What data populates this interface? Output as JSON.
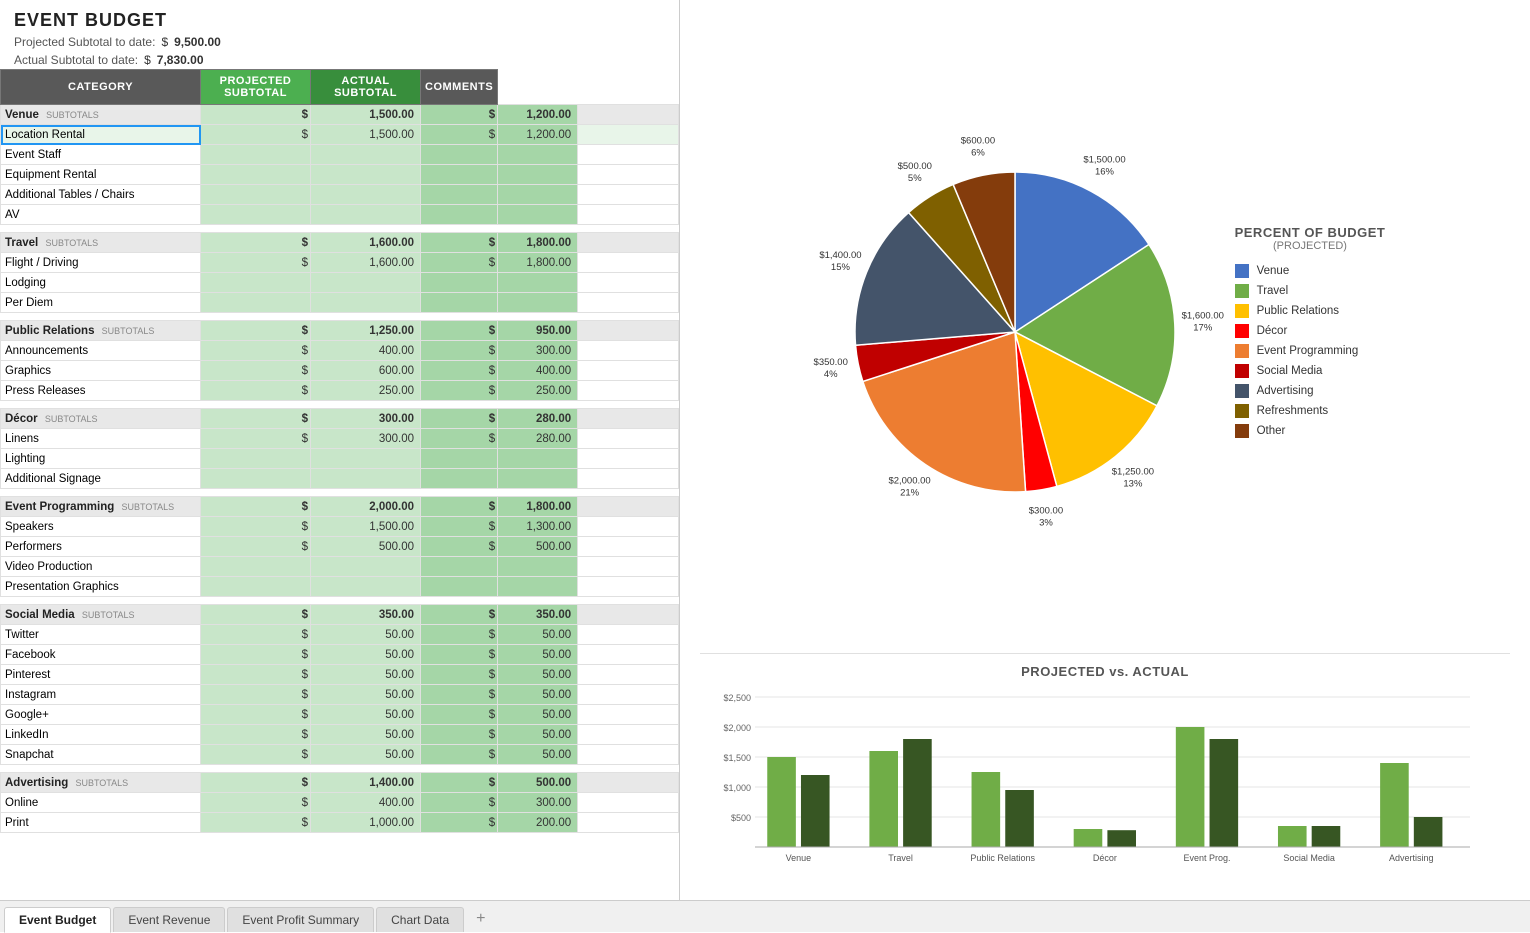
{
  "title": "EVENT BUDGET",
  "summary": {
    "projected_label": "Projected Subtotal to date:",
    "projected_dollar": "$",
    "projected_value": "9,500.00",
    "actual_label": "Actual Subtotal to date:",
    "actual_dollar": "$",
    "actual_value": "7,830.00"
  },
  "table": {
    "headers": {
      "category": "CATEGORY",
      "projected": "PROJECTED SUBTOTAL",
      "actual": "ACTUAL SUBTOTAL",
      "comments": "COMMENTS"
    },
    "sections": [
      {
        "name": "Venue",
        "proj": "1,500.00",
        "act": "1,200.00",
        "items": [
          {
            "label": "Location Rental",
            "proj": "1,500.00",
            "act": "1,200.00",
            "highlighted": true,
            "selected": true
          },
          {
            "label": "Event Staff",
            "proj": "",
            "act": ""
          },
          {
            "label": "Equipment Rental",
            "proj": "",
            "act": ""
          },
          {
            "label": "Additional Tables / Chairs",
            "proj": "",
            "act": ""
          },
          {
            "label": "AV",
            "proj": "",
            "act": ""
          }
        ]
      },
      {
        "name": "Travel",
        "proj": "1,600.00",
        "act": "1,800.00",
        "items": [
          {
            "label": "Flight / Driving",
            "proj": "1,600.00",
            "act": "1,800.00"
          },
          {
            "label": "Lodging",
            "proj": "",
            "act": ""
          },
          {
            "label": "Per Diem",
            "proj": "",
            "act": ""
          }
        ]
      },
      {
        "name": "Public Relations",
        "proj": "1,250.00",
        "act": "950.00",
        "items": [
          {
            "label": "Announcements",
            "proj": "400.00",
            "act": "300.00"
          },
          {
            "label": "Graphics",
            "proj": "600.00",
            "act": "400.00"
          },
          {
            "label": "Press Releases",
            "proj": "250.00",
            "act": "250.00"
          }
        ]
      },
      {
        "name": "Décor",
        "proj": "300.00",
        "act": "280.00",
        "items": [
          {
            "label": "Linens",
            "proj": "300.00",
            "act": "280.00"
          },
          {
            "label": "Lighting",
            "proj": "",
            "act": ""
          },
          {
            "label": "Additional Signage",
            "proj": "",
            "act": ""
          }
        ]
      },
      {
        "name": "Event Programming",
        "proj": "2,000.00",
        "act": "1,800.00",
        "items": [
          {
            "label": "Speakers",
            "proj": "1,500.00",
            "act": "1,300.00"
          },
          {
            "label": "Performers",
            "proj": "500.00",
            "act": "500.00"
          },
          {
            "label": "Video Production",
            "proj": "",
            "act": ""
          },
          {
            "label": "Presentation Graphics",
            "proj": "",
            "act": ""
          }
        ]
      },
      {
        "name": "Social Media",
        "proj": "350.00",
        "act": "350.00",
        "items": [
          {
            "label": "Twitter",
            "proj": "50.00",
            "act": "50.00"
          },
          {
            "label": "Facebook",
            "proj": "50.00",
            "act": "50.00"
          },
          {
            "label": "Pinterest",
            "proj": "50.00",
            "act": "50.00"
          },
          {
            "label": "Instagram",
            "proj": "50.00",
            "act": "50.00"
          },
          {
            "label": "Google+",
            "proj": "50.00",
            "act": "50.00"
          },
          {
            "label": "LinkedIn",
            "proj": "50.00",
            "act": "50.00"
          },
          {
            "label": "Snapchat",
            "proj": "50.00",
            "act": "50.00"
          }
        ]
      },
      {
        "name": "Advertising",
        "proj": "1,400.00",
        "act": "500.00",
        "items": [
          {
            "label": "Online",
            "proj": "400.00",
            "act": "300.00"
          },
          {
            "label": "Print",
            "proj": "1,000.00",
            "act": "200.00"
          }
        ]
      }
    ]
  },
  "pie_chart": {
    "title": "PERCENT OF BUDGET",
    "subtitle": "(PROJECTED)",
    "segments": [
      {
        "label": "Venue",
        "value": 1500,
        "pct": 16,
        "color": "#4472C4",
        "display": "$1,500.00\n16%"
      },
      {
        "label": "Travel",
        "value": 1600,
        "pct": 17,
        "color": "#70AD47",
        "display": "$1,600.00\n17%"
      },
      {
        "label": "Public Relations",
        "value": 1250,
        "pct": 13,
        "color": "#FFC000",
        "display": "$1,250.00\n13%"
      },
      {
        "label": "Décor",
        "value": 300,
        "pct": 3,
        "color": "#FF0000",
        "display": "$300.00\n3%"
      },
      {
        "label": "Event Programming",
        "value": 2000,
        "pct": 21,
        "color": "#ED7D31",
        "display": "$2,000.00\n21%"
      },
      {
        "label": "Social Media",
        "value": 350,
        "pct": 4,
        "color": "#C00000",
        "display": "$350.00\n4%"
      },
      {
        "label": "Advertising",
        "value": 1400,
        "pct": 15,
        "color": "#44546A",
        "display": "$1,400.00\n15%"
      },
      {
        "label": "Refreshments",
        "value": 500,
        "pct": 5,
        "color": "#7F6000",
        "display": "$500.00\n5%"
      },
      {
        "label": "Other",
        "value": 600,
        "pct": 6,
        "color": "#843C0C",
        "display": "$600.00\n6%"
      }
    ]
  },
  "bar_chart": {
    "title": "PROJECTED vs. ACTUAL",
    "y_labels": [
      "$2,500",
      "$2,000",
      "$1,500",
      "$1,000"
    ],
    "categories": [
      "Venue",
      "Travel",
      "Public\nRelations",
      "Décor",
      "Event\nProg.",
      "Social\nMedia",
      "Advertising"
    ],
    "projected": [
      1500,
      1600,
      1250,
      300,
      2000,
      350,
      1400
    ],
    "actual": [
      1200,
      1800,
      950,
      280,
      1800,
      350,
      500
    ],
    "proj_color": "#70AD47",
    "act_color": "#375623"
  },
  "tabs": [
    {
      "label": "Event Budget",
      "active": true
    },
    {
      "label": "Event Revenue",
      "active": false
    },
    {
      "label": "Event Profit Summary",
      "active": false
    },
    {
      "label": "Chart Data",
      "active": false
    }
  ]
}
